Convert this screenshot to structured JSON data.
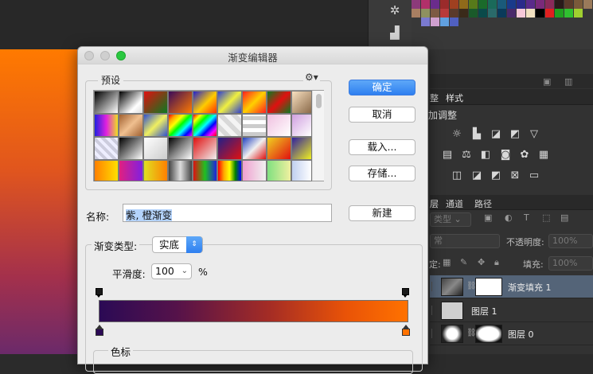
{
  "dialog": {
    "title": "渐变编辑器",
    "presets_label": "预设",
    "presets_menu_icon": "gear-icon",
    "buttons": {
      "ok": "确定",
      "cancel": "取消",
      "load": "载入...",
      "save": "存储...",
      "new": "新建"
    },
    "name_label": "名称:",
    "name_value": "紫, 橙渐变",
    "gradient_type_label": "渐变类型:",
    "gradient_type_value": "实底",
    "smoothness_label": "平滑度:",
    "smoothness_value": "100",
    "smoothness_unit": "%",
    "color_stops_label": "色标",
    "gradient_colors": [
      "#2b0a55",
      "#ff7200"
    ],
    "start_color": "#2b0a55",
    "end_color": "#ff7200"
  },
  "panels": {
    "tab_adjust_partial": "整",
    "tab_styles": "样式",
    "adjustments_title": "加调整",
    "layers_tabs": {
      "layers_partial": "层",
      "channels": "通道",
      "paths": "路径"
    },
    "kind_label": "类型",
    "blend_mode_partial": "常",
    "opacity_label": "不透明度:",
    "opacity_value": "100%",
    "lock_label_partial": "定:",
    "fill_label": "填充:",
    "fill_value": "100%",
    "layers": [
      {
        "name": "渐变填充 1",
        "selected": true
      },
      {
        "name": "图层 1",
        "selected": false
      },
      {
        "name": "图层 0",
        "selected": false
      }
    ]
  }
}
